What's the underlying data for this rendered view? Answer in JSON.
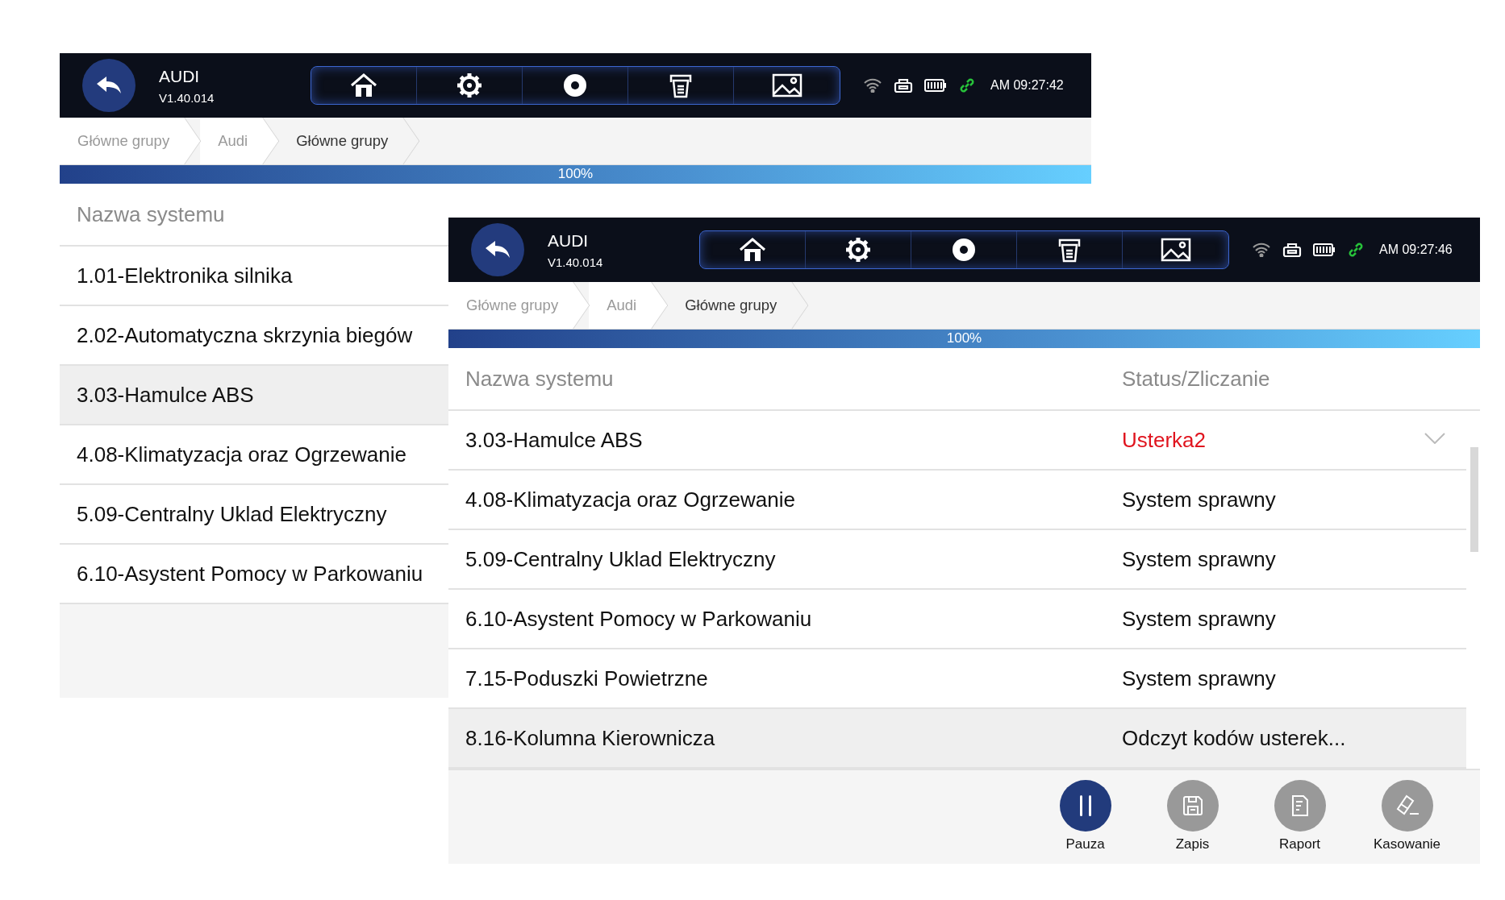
{
  "screens": [
    {
      "title": "AUDI",
      "version": "V1.40.014",
      "time": "AM 09:27:42",
      "breadcrumbs": [
        {
          "label": "Główne grupy",
          "selected": false
        },
        {
          "label": "Audi",
          "selected": false
        },
        {
          "label": "Główne grupy",
          "selected": true
        }
      ],
      "progress": {
        "level": 1,
        "label": "100%"
      },
      "columns": [
        "Nazwa systemu"
      ],
      "rows": [
        {
          "name": "1.01-Elektronika silnika",
          "selected": false
        },
        {
          "name": "2.02-Automatyczna skrzynia biegów",
          "selected": false
        },
        {
          "name": "3.03-Hamulce ABS",
          "selected": true
        },
        {
          "name": "4.08-Klimatyzacja oraz Ogrzewanie",
          "selected": false
        },
        {
          "name": "5.09-Centralny Uklad Elektryczny",
          "selected": false
        },
        {
          "name": "6.10-Asystent Pomocy w Parkowaniu",
          "selected": false
        }
      ]
    },
    {
      "title": "AUDI",
      "version": "V1.40.014",
      "time": "AM 09:27:46",
      "breadcrumbs": [
        {
          "label": "Główne grupy",
          "selected": false
        },
        {
          "label": "Audi",
          "selected": false
        },
        {
          "label": "Główne grupy",
          "selected": true
        }
      ],
      "progress": {
        "level": 1,
        "label": "100%"
      },
      "columns": [
        "Nazwa systemu",
        "Status/Zliczanie"
      ],
      "scrollable": true,
      "rows": [
        {
          "name": "3.03-Hamulce ABS",
          "status": "Usterka2",
          "kind": "fault",
          "selected": false
        },
        {
          "name": "4.08-Klimatyzacja oraz Ogrzewanie",
          "status": "System sprawny",
          "kind": "ok",
          "selected": false
        },
        {
          "name": "5.09-Centralny Uklad Elektryczny",
          "status": "System sprawny",
          "kind": "ok",
          "selected": false
        },
        {
          "name": "6.10-Asystent Pomocy w Parkowaniu",
          "status": "System sprawny",
          "kind": "ok",
          "selected": false
        },
        {
          "name": "7.15-Poduszki Powietrzne",
          "status": "System sprawny",
          "kind": "ok",
          "selected": false
        },
        {
          "name": "8.16-Kolumna Kierownicza",
          "status": "Odczyt kodów usterek...",
          "kind": "busy",
          "selected": true
        }
      ],
      "actions": [
        {
          "label": "Pauza",
          "kind": "pause",
          "disabled": false
        },
        {
          "label": "Zapis",
          "kind": "save",
          "disabled": true
        },
        {
          "label": "Raport",
          "kind": "report",
          "disabled": true
        },
        {
          "label": "Kasowanie",
          "kind": "erase",
          "disabled": true
        }
      ]
    }
  ]
}
